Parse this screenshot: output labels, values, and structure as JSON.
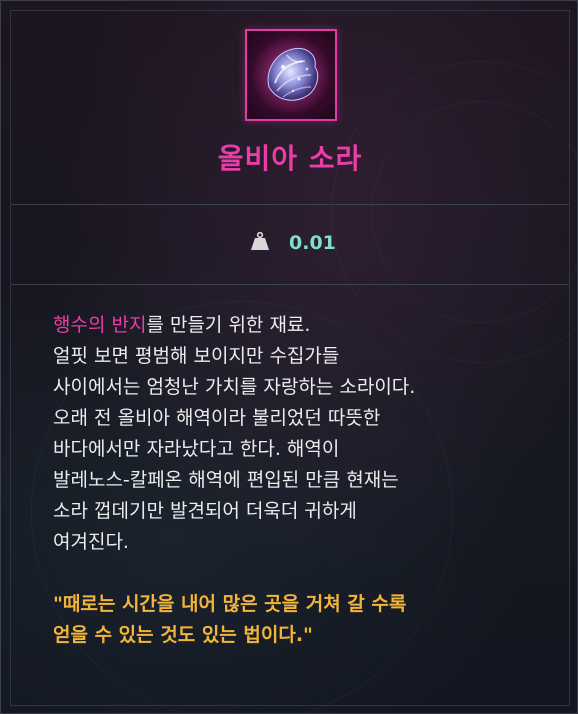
{
  "item": {
    "name": "올비아 소라",
    "icon": "seashell-icon",
    "rarity_color": "#ea3da8"
  },
  "weight": {
    "icon": "weight-icon",
    "value": "0.01"
  },
  "description": {
    "first_line_highlight": "행수의 반지",
    "first_line_rest": "를 만들기 위한 재료.",
    "lines": [
      "얼핏 보면 평범해 보이지만 수집가들",
      "사이에서는 엄청난 가치를 자랑하는 소라이다.",
      "오래 전 올비아 해역이라 불리었던 따뜻한",
      "바다에서만 자라났다고 한다. 해역이",
      "발레노스-칼페온 해역에 편입된 만큼 현재는",
      "소라 껍데기만 발견되어 더욱더 귀하게",
      "여겨진다."
    ],
    "quote_lines": [
      "\"때로는 시간을 내어 많은 곳을 거쳐 갈 수록",
      "얻을 수 있는 것도 있는 법이다.\""
    ]
  },
  "colors": {
    "highlight": "#ea3da8",
    "weight_value": "#7fe0c8",
    "quote": "#f2b53a",
    "border": "#3a404c"
  }
}
